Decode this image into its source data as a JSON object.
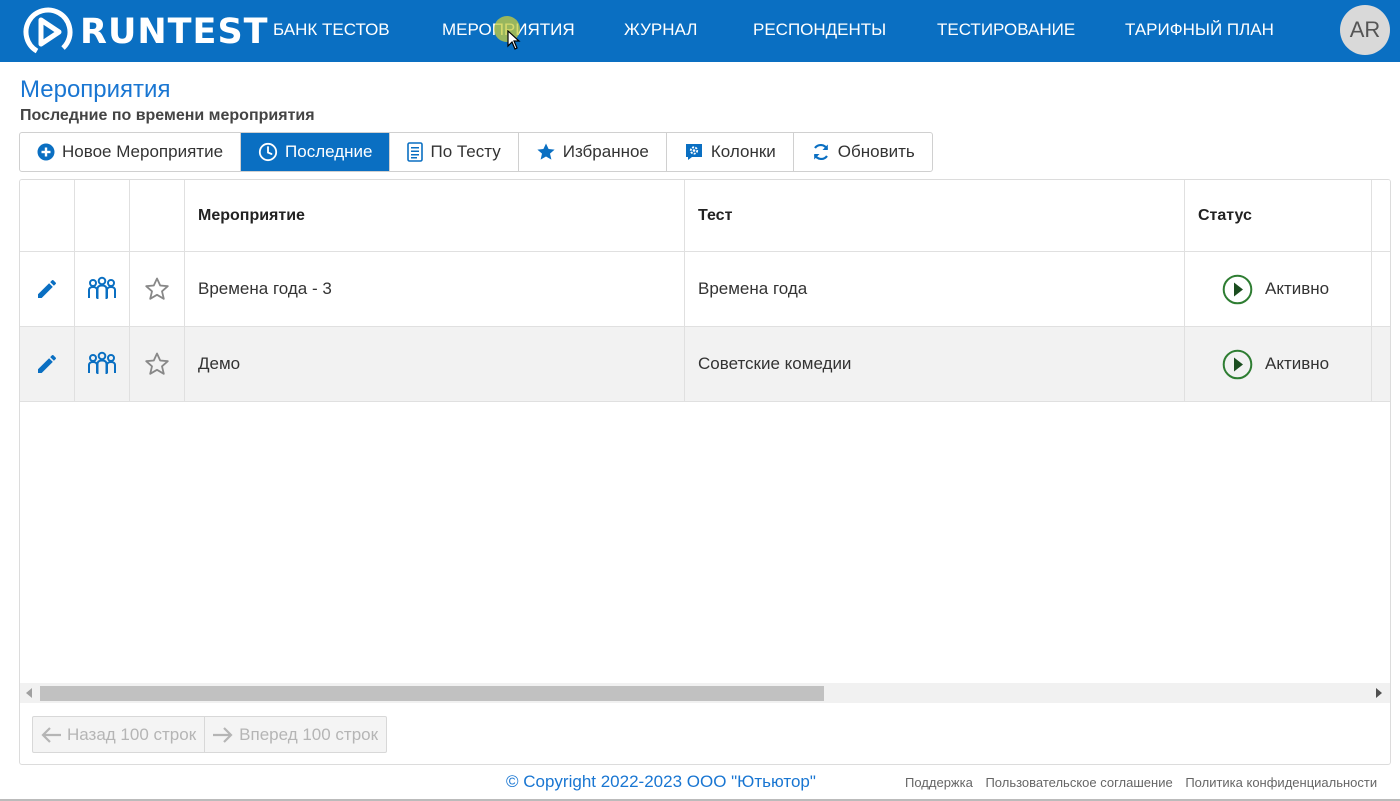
{
  "header": {
    "logo_text": "RUNTEST",
    "nav": [
      "БАНК ТЕСТОВ",
      "МЕРОПРИЯТИЯ",
      "ЖУРНАЛ",
      "РЕСПОНДЕНТЫ",
      "ТЕСТИРОВАНИЕ",
      "ТАРИФНЫЙ ПЛАН"
    ],
    "avatar_initials": "AR",
    "brand_color": "#0a6fc2"
  },
  "page": {
    "title": "Мероприятия",
    "subtitle": "Последние по времени мероприятия"
  },
  "toolbar": {
    "buttons": [
      {
        "label": "Новое Мероприятие",
        "icon": "plus-circle-icon",
        "active": false
      },
      {
        "label": "Последние",
        "icon": "clock-icon",
        "active": true
      },
      {
        "label": "По Тесту",
        "icon": "document-list-icon",
        "active": false
      },
      {
        "label": "Избранное",
        "icon": "star-icon",
        "active": false
      },
      {
        "label": "Колонки",
        "icon": "columns-settings-icon",
        "active": false
      },
      {
        "label": "Обновить",
        "icon": "refresh-icon",
        "active": false
      }
    ]
  },
  "table": {
    "columns": [
      "Мероприятие",
      "Тест",
      "Статус"
    ],
    "rows": [
      {
        "event": "Времена года - 3",
        "test": "Времена года",
        "status": "Активно"
      },
      {
        "event": "Демо",
        "test": "Советские комедии",
        "status": "Активно"
      }
    ],
    "icons": [
      "edit-pencil-icon",
      "group-users-icon",
      "favorite-star-icon",
      "play-status-icon"
    ]
  },
  "pager": {
    "prev_label": "Назад 100 строк",
    "next_label": "Вперед 100 строк"
  },
  "footer": {
    "copyright": "© Copyright 2022-2023 ООО \"Ютьютор\"",
    "links": [
      "Поддержка",
      "Пользовательское соглашение",
      "Политика конфиденциальности"
    ]
  }
}
